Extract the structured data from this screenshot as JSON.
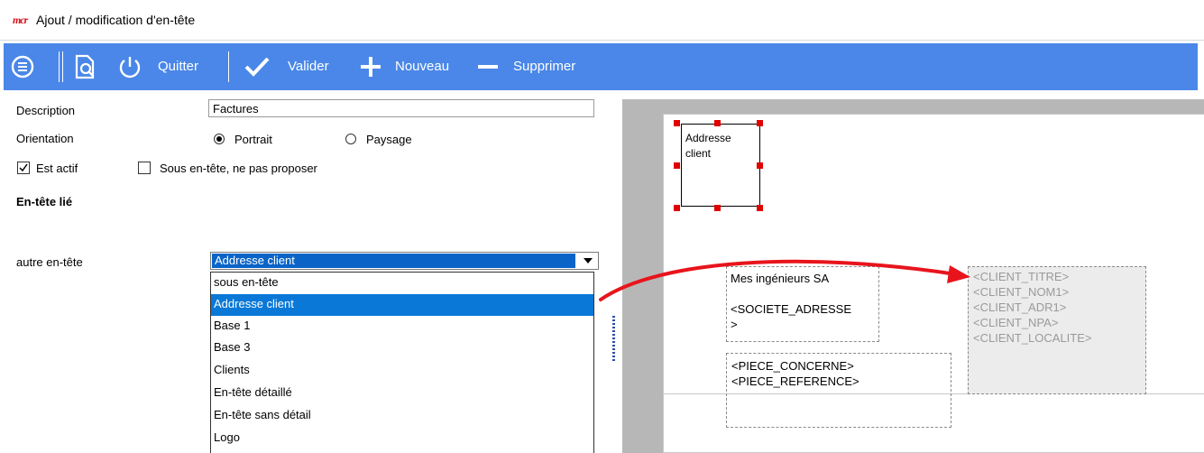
{
  "window": {
    "logo_text": "mcr",
    "title": "Ajout / modification d'en-tête"
  },
  "toolbar": {
    "quit_label": "Quitter",
    "validate_label": "Valider",
    "new_label": "Nouveau",
    "delete_label": "Supprimer",
    "background_color": "#4a87e8"
  },
  "form": {
    "description_label": "Description",
    "description_value": "Factures",
    "orientation_label": "Orientation",
    "orientation_options": [
      {
        "label": "Portrait",
        "selected": true
      },
      {
        "label": "Paysage",
        "selected": false
      }
    ],
    "est_actif_label": "Est actif",
    "est_actif_checked": true,
    "sous_entete_label": "Sous en-tête, ne pas proposer",
    "sous_entete_checked": false,
    "section_heading": "En-tête lié",
    "autre_entete_label": "autre en-tête",
    "autre_entete_value": "Addresse client",
    "dropdown_items": [
      "sous en-tête",
      "Addresse client",
      "Base 1",
      "Base 3",
      "Clients",
      "En-tête détaillé",
      "En-tête sans détail",
      "Logo"
    ],
    "dropdown_selected_index": 1
  },
  "preview": {
    "selected_block_text": [
      "Addresse",
      "client"
    ],
    "company_block": [
      "Mes ingénieurs SA",
      "",
      "<SOCIETE_ADRESSE",
      ">"
    ],
    "piece_block": [
      "<PIECE_CONCERNE>",
      "<PIECE_REFERENCE>"
    ],
    "client_block": [
      "<CLIENT_TITRE>",
      "<CLIENT_NOM1>",
      "<CLIENT_ADR1>",
      "<CLIENT_NPA>",
      "<CLIENT_LOCALITE>"
    ],
    "arrow_color": "#e8141c"
  }
}
